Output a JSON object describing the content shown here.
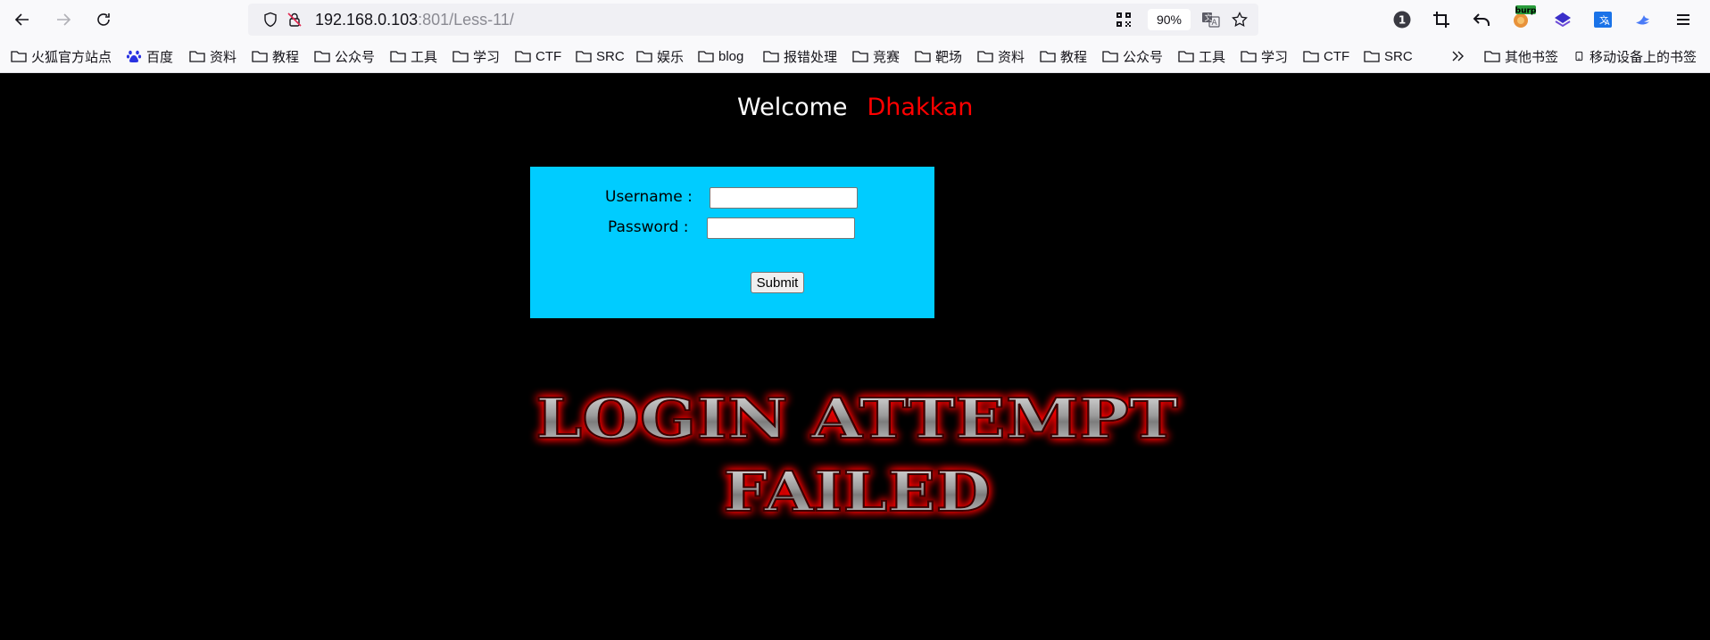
{
  "browser": {
    "url_host": "192.168.0.103",
    "url_path": ":801/Less-11/",
    "zoom": "90%",
    "notification_badge": "1",
    "burp_label": "burp"
  },
  "bookmarks": [
    {
      "label": "火狐官方站点",
      "icon": "folder-icon"
    },
    {
      "label": "百度",
      "icon": "baidu-paw-icon"
    },
    {
      "label": "资料",
      "icon": "folder-icon"
    },
    {
      "label": "教程",
      "icon": "folder-icon"
    },
    {
      "label": "公众号",
      "icon": "folder-icon"
    },
    {
      "label": "工具",
      "icon": "folder-icon"
    },
    {
      "label": "学习",
      "icon": "folder-icon"
    },
    {
      "label": "CTF",
      "icon": "folder-icon"
    },
    {
      "label": "SRC",
      "icon": "folder-icon"
    },
    {
      "label": "娱乐",
      "icon": "folder-icon"
    },
    {
      "label": "blog",
      "icon": "folder-icon"
    },
    {
      "label": "报错处理",
      "icon": "folder-icon"
    },
    {
      "label": "竞赛",
      "icon": "folder-icon"
    },
    {
      "label": "靶场",
      "icon": "folder-icon"
    },
    {
      "label": "资料",
      "icon": "folder-icon"
    },
    {
      "label": "教程",
      "icon": "folder-icon"
    },
    {
      "label": "公众号",
      "icon": "folder-icon"
    },
    {
      "label": "工具",
      "icon": "folder-icon"
    },
    {
      "label": "学习",
      "icon": "folder-icon"
    },
    {
      "label": "CTF",
      "icon": "folder-icon"
    },
    {
      "label": "SRC",
      "icon": "folder-icon"
    }
  ],
  "bookmarks_right": {
    "other": "其他书签",
    "mobile": "移动设备上的书签"
  },
  "page": {
    "welcome": "Welcome",
    "name": "Dhakkan",
    "username_label": "Username :",
    "password_label": "Password :",
    "username_value": "",
    "password_value": "",
    "submit_label": "Submit",
    "failed_line1": "LOGIN ATTEMPT",
    "failed_line2": "FAILED"
  },
  "colors": {
    "page_bg": "#000000",
    "form_bg": "#00ccff",
    "name_red": "#ff0000",
    "failed_glow": "#ff0000"
  }
}
